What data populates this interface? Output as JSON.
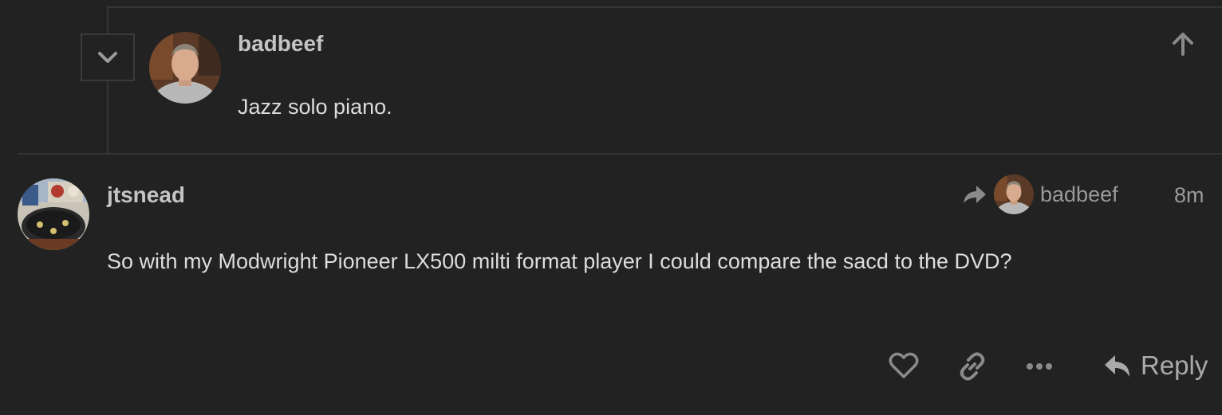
{
  "embedded_reply": {
    "username": "badbeef",
    "text": "Jazz solo piano.",
    "collapse_icon": "chevron-down-icon",
    "goto_icon": "arrow-up-icon"
  },
  "post": {
    "username": "jtsnead",
    "reply_to_icon": "share-arrow-icon",
    "reply_to_username": "badbeef",
    "time": "8m",
    "body": "So with my Modwright Pioneer LX500 milti format player I could compare the sacd to the DVD?"
  },
  "actions": {
    "like_icon": "heart-icon",
    "link_icon": "link-icon",
    "more_icon": "ellipsis-icon",
    "reply_icon": "reply-arrow-icon",
    "reply_label": "Reply"
  },
  "colors": {
    "background": "#222222",
    "text": "#dddddd",
    "muted": "#9a9a9a",
    "border": "#353535"
  }
}
